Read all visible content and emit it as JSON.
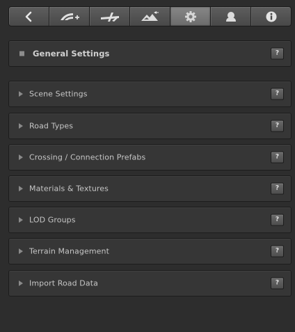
{
  "toolbar": {
    "tabs": [
      {
        "icon": "back-arrow-icon"
      },
      {
        "icon": "add-road-icon"
      },
      {
        "icon": "road-intersection-icon"
      },
      {
        "icon": "terrain-icon"
      },
      {
        "icon": "gear-icon",
        "active": true
      },
      {
        "icon": "user-icon"
      },
      {
        "icon": "info-icon"
      }
    ]
  },
  "general": {
    "label": "General Settings",
    "help": "?"
  },
  "sections": [
    {
      "label": "Scene Settings",
      "help": "?"
    },
    {
      "label": "Road Types",
      "help": "?"
    },
    {
      "label": "Crossing / Connection Prefabs",
      "help": "?"
    },
    {
      "label": "Materials & Textures",
      "help": "?"
    },
    {
      "label": "LOD Groups",
      "help": "?"
    },
    {
      "label": "Terrain Management",
      "help": "?"
    },
    {
      "label": "Import Road Data",
      "help": "?"
    }
  ],
  "colors": {
    "background": "#2d2d2d",
    "panel": "#363636",
    "text": "#c6c6c6",
    "active_tab": "#7a7a7a"
  }
}
